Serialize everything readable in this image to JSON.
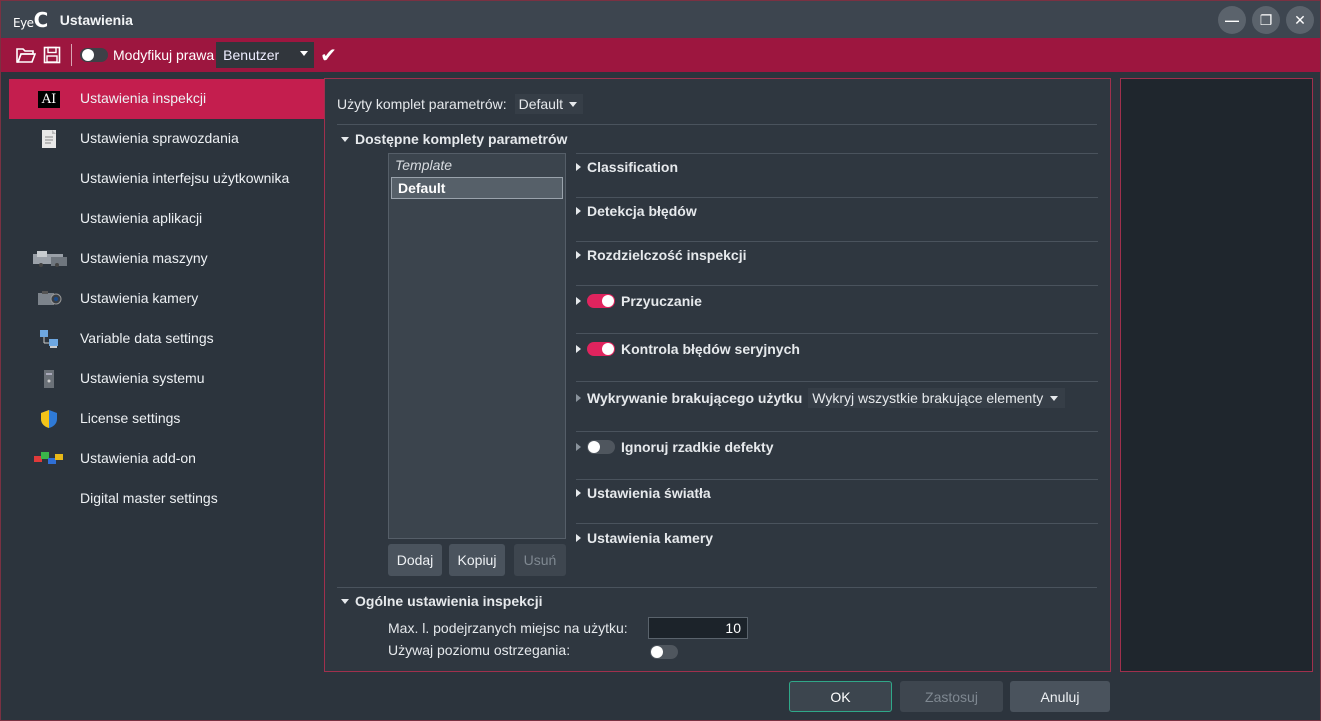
{
  "window": {
    "logo_small": "Eye",
    "logo_big": "C",
    "title": "Ustawienia"
  },
  "toolbar": {
    "modify_label": "Modyfikuj prawa",
    "user_combo": "Benutzer"
  },
  "sidebar": {
    "items": [
      {
        "label": "Ustawienia inspekcji",
        "icon": "ai-icon",
        "active": true
      },
      {
        "label": "Ustawienia sprawozdania",
        "icon": "document-icon"
      },
      {
        "label": "Ustawienia interfejsu użytkownika",
        "icon": ""
      },
      {
        "label": "Ustawienia aplikacji",
        "icon": ""
      },
      {
        "label": "Ustawienia maszyny",
        "icon": "machine-icon"
      },
      {
        "label": "Ustawienia kamery",
        "icon": "camera-icon"
      },
      {
        "label": "Variable data settings",
        "icon": "network-icon"
      },
      {
        "label": "Ustawienia systemu",
        "icon": "computer-icon"
      },
      {
        "label": "License settings",
        "icon": "shield-icon"
      },
      {
        "label": "Ustawienia add-on",
        "icon": "puzzle-icon"
      },
      {
        "label": "Digital master settings",
        "icon": ""
      }
    ]
  },
  "main": {
    "used_set_label": "Użyty komplet parametrów:",
    "used_set_value": "Default",
    "available_title": "Dostępne komplety parametrów",
    "param_sets": [
      "Template",
      "Default"
    ],
    "buttons": {
      "add": "Dodaj",
      "copy": "Kopiuj",
      "remove": "Usuń"
    },
    "groups": {
      "classification": "Classification",
      "detection": "Detekcja błędów",
      "resolution": "Rozdzielczość inspekcji",
      "learning": "Przyuczanie",
      "serial": "Kontrola błędów seryjnych",
      "missing": "Wykrywanie brakującego użytku",
      "missing_combo": "Wykryj wszystkie brakujące elementy",
      "ignore": "Ignoruj rzadkie defekty",
      "light": "Ustawienia światła",
      "camera": "Ustawienia kamery"
    },
    "general_title": "Ogólne ustawienia inspekcji",
    "max_label": "Max. l. podejrzanych miejsc na użytku:",
    "max_value": "10",
    "warning_label": "Używaj poziomu ostrzegania:"
  },
  "footer": {
    "ok": "OK",
    "apply": "Zastosuj",
    "cancel": "Anuluj"
  }
}
